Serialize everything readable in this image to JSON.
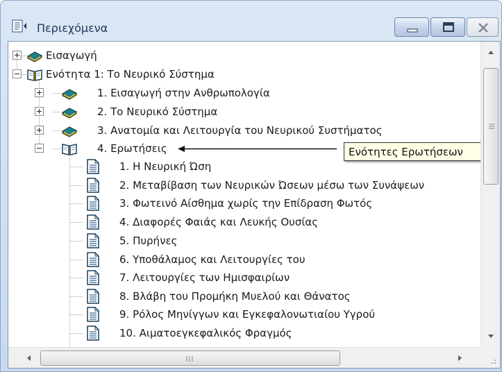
{
  "window": {
    "title": "Περιεχόμενα",
    "icons": [
      "contents-window-icon",
      "minimize-icon",
      "maximize-icon",
      "close-icon"
    ]
  },
  "tree": {
    "items": [
      {
        "label": "Εισαγωγή",
        "icon": "book-closed-icon",
        "expander": "plus"
      },
      {
        "label": "Ενότητα   1:  Το Νευρικό Σύστημα",
        "icon": "book-open-icon",
        "expander": "minus"
      },
      {
        "label": "1.  Εισαγωγή στην Ανθρωπολογία",
        "icon": "book-closed-icon",
        "expander": "plus"
      },
      {
        "label": "2.  Το Νευρικό Σύστημα",
        "icon": "book-closed-icon",
        "expander": "plus"
      },
      {
        "label": "3.  Ανατομία και Λειτουργία του Νευρικού Συστήματος",
        "icon": "book-closed-icon",
        "expander": "plus"
      },
      {
        "label": "4.  Ερωτήσεις",
        "icon": "book-open-icon",
        "expander": "minus"
      },
      {
        "label": "1.  Η Νευρική Ώση",
        "icon": "page-icon"
      },
      {
        "label": "2.  Μεταβίβαση των Νευρικών Ώσεων μέσω των Συνάψεων",
        "icon": "page-icon"
      },
      {
        "label": "3.  Φωτεινό Αίσθημα χωρίς την Επίδραση Φωτός",
        "icon": "page-icon"
      },
      {
        "label": "4.  Διαφορές Φαιάς και Λευκής Ουσίας",
        "icon": "page-icon"
      },
      {
        "label": "5.  Πυρήνες",
        "icon": "page-icon"
      },
      {
        "label": "6.  Υποθάλαμος και Λειτουργίες του",
        "icon": "page-icon"
      },
      {
        "label": "7.  Λειτουργίες των Ημισφαιρίων",
        "icon": "page-icon"
      },
      {
        "label": "8.  Βλάβη του Προμήκη Μυελού και Θάνατος",
        "icon": "page-icon"
      },
      {
        "label": "9.  Ρόλος Μηνίγγων και Εγκεφαλονωτιαίου Υγρού",
        "icon": "page-icon"
      },
      {
        "label": "10.  Αιματοεγκεφαλικός Φραγμός",
        "icon": "page-icon"
      }
    ]
  },
  "tooltip": {
    "text": "Ενότητες Ερωτήσεων"
  },
  "colors": {
    "book_teal": "#1f7f86",
    "book_olive": "#8a8a1e",
    "tooltip_bg": "#ffffe6",
    "title_text": "#1e395b"
  }
}
